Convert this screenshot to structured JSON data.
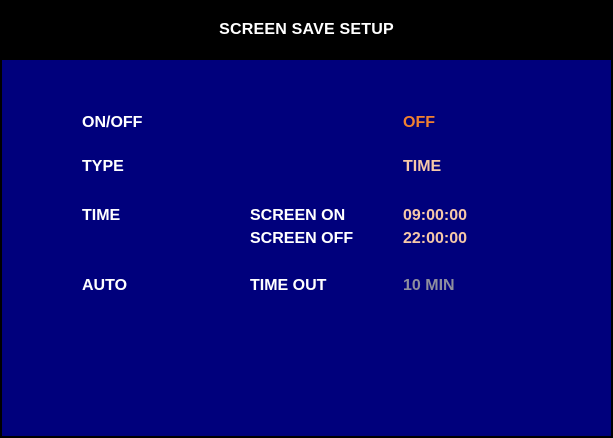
{
  "title": "SCREEN SAVE SETUP",
  "rows": {
    "onoff": {
      "label": "ON/OFF",
      "value": "OFF"
    },
    "type": {
      "label": "TYPE",
      "value": "TIME"
    },
    "time": {
      "label": "TIME",
      "screen_on_label": "SCREEN ON",
      "screen_on_value": "09:00:00",
      "screen_off_label": "SCREEN OFF",
      "screen_off_value": "22:00:00"
    },
    "auto": {
      "label": "AUTO",
      "timeout_label": "TIME OUT",
      "timeout_value": "10 MIN"
    }
  },
  "colors": {
    "background": "#00007c",
    "titlebar": "#000000",
    "label": "#ffffff",
    "value": "#f6c8a8",
    "value_highlight": "#f08030",
    "value_disabled": "#8e8e9e"
  }
}
